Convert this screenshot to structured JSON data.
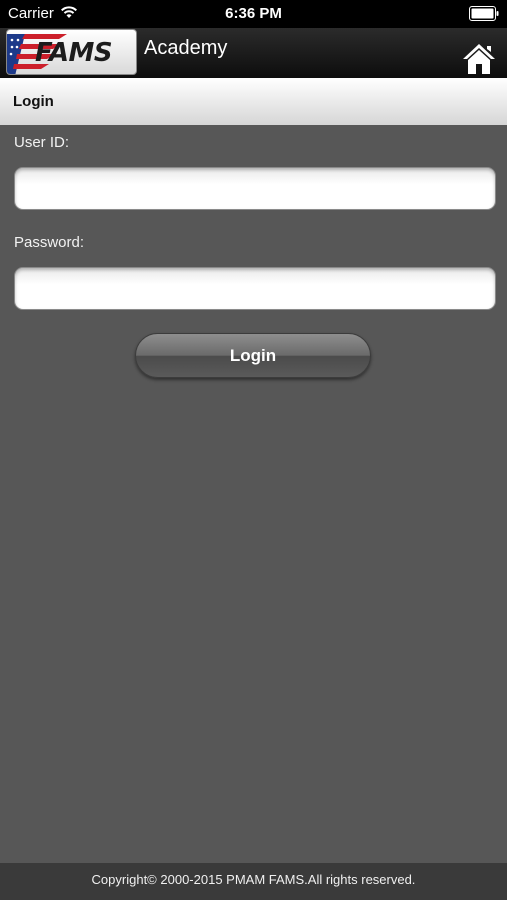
{
  "status_bar": {
    "carrier": "Carrier",
    "time": "6:36 PM",
    "wifi_icon": "wifi-icon",
    "battery_icon": "battery-icon"
  },
  "header": {
    "logo_text": "FAMS",
    "title": "Academy",
    "home_icon": "home-icon"
  },
  "section": {
    "title": "Login"
  },
  "form": {
    "user_id_label": "User ID:",
    "user_id_value": "",
    "password_label": "Password:",
    "password_value": "",
    "login_label": "Login"
  },
  "footer": {
    "copyright": "Copyright© 2000-2015 PMAM FAMS.All rights reserved."
  },
  "colors": {
    "background": "#575757",
    "header": "#1a1a1a",
    "footer": "#3a3a3a",
    "section_bar": "#e6e6e6"
  }
}
